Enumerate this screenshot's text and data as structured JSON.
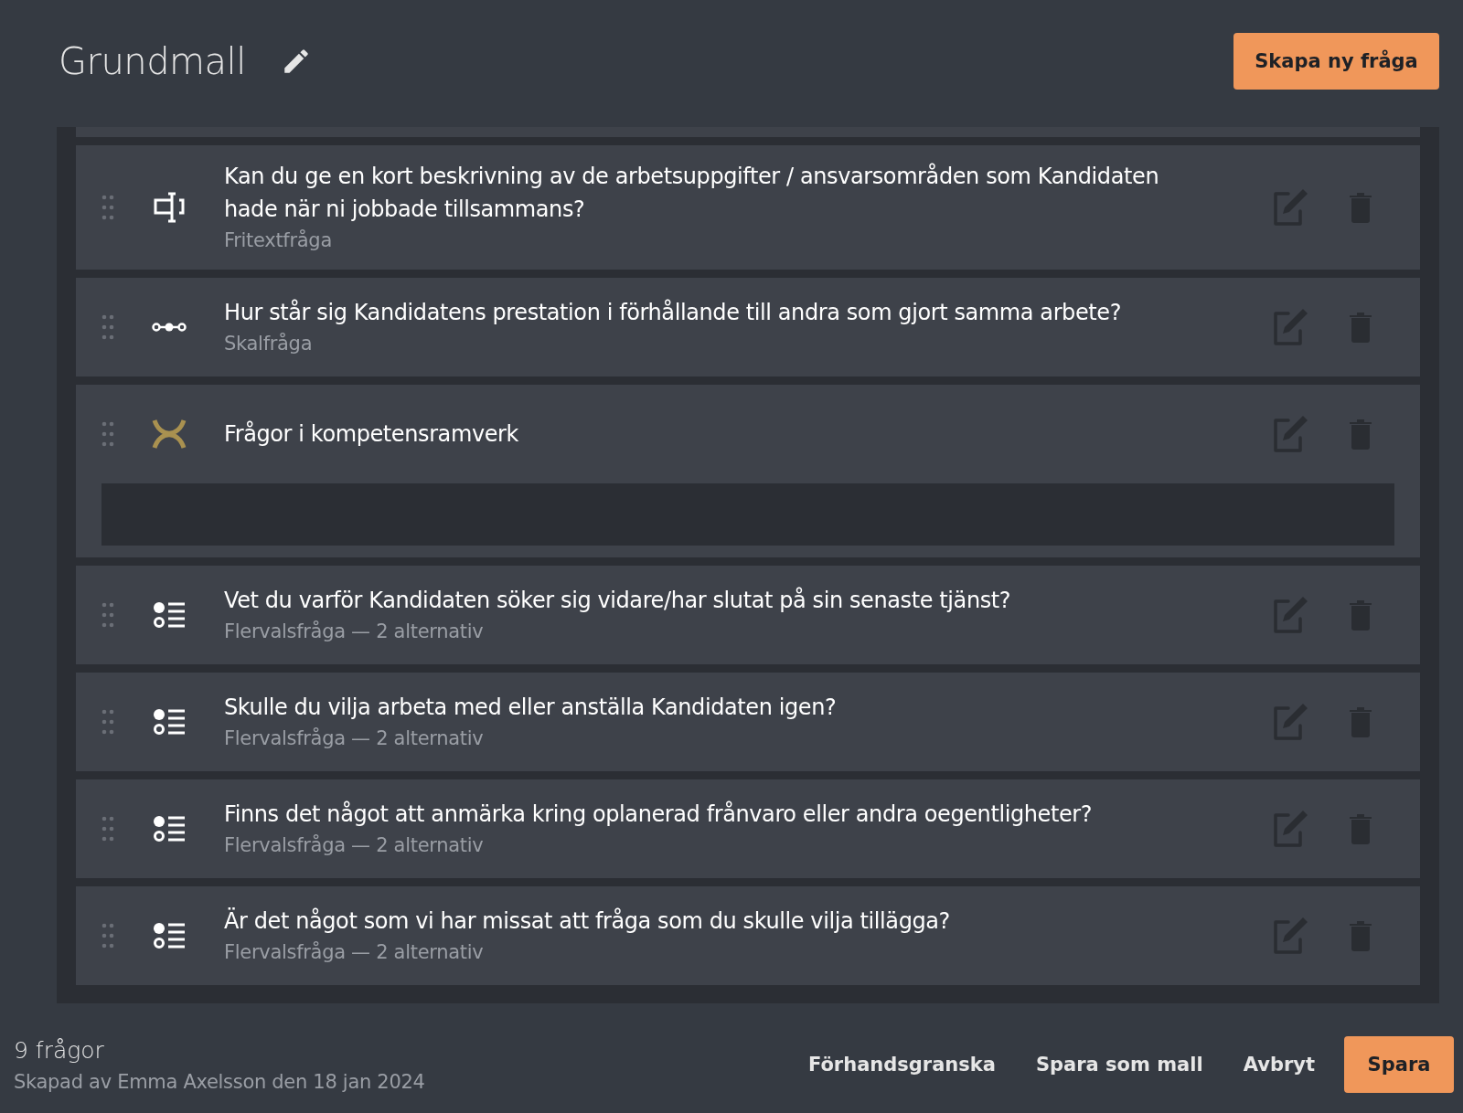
{
  "header": {
    "title": "Grundmall",
    "create_button": "Skapa ny fråga"
  },
  "questions": [
    {
      "kind": "text",
      "title": "Kan du ge en kort beskrivning av de arbetsuppgifter / ansvarsområden som Kandidaten hade när ni jobbade tillsammans?",
      "subtitle": "Fritextfråga"
    },
    {
      "kind": "scale",
      "title": "Hur står sig Kandidatens prestation i förhållande till andra som gjort samma arbete?",
      "subtitle": "Skalfråga"
    },
    {
      "kind": "framework",
      "title": "Frågor i kompetensramverk"
    },
    {
      "kind": "choice",
      "title": "Vet du varför Kandidaten söker sig vidare/har slutat på sin senaste tjänst?",
      "subtitle": "Flervalsfråga — 2 alternativ"
    },
    {
      "kind": "choice",
      "title": "Skulle du vilja arbeta med eller anställa Kandidaten igen?",
      "subtitle": "Flervalsfråga — 2 alternativ"
    },
    {
      "kind": "choice",
      "title": "Finns det något att anmärka kring oplanerad frånvaro eller andra oegentligheter?",
      "subtitle": "Flervalsfråga — 2 alternativ"
    },
    {
      "kind": "choice",
      "title": "Är det något som vi har missat att fråga som du skulle vilja tillägga?",
      "subtitle": "Flervalsfråga — 2 alternativ"
    }
  ],
  "footer": {
    "count": "9 frågor",
    "created": "Skapad av Emma Axelsson den 18 jan 2024",
    "actions": [
      "Förhandsgranska",
      "Spara som mall",
      "Avbryt"
    ],
    "save_button": "Spara"
  }
}
